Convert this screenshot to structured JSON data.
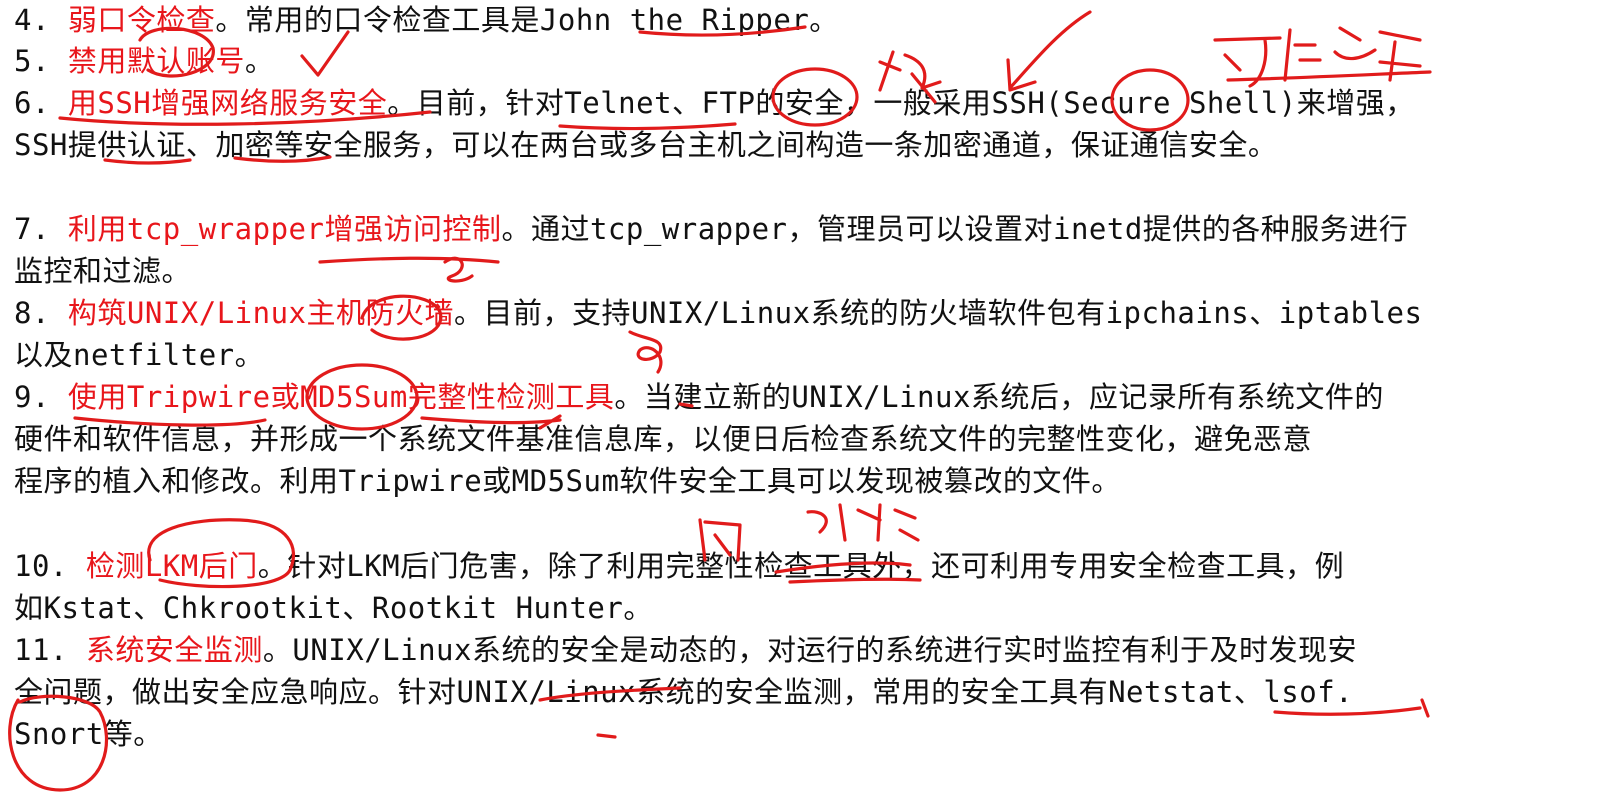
{
  "items": [
    {
      "num": "4. ",
      "title": "弱口令检查",
      "body": "。常用的口令检查工具是John the Ripper。"
    },
    {
      "num": "5. ",
      "title": "禁用默认账号",
      "body": "。"
    },
    {
      "num": "6. ",
      "title": "用SSH增强网络服务安全",
      "body": "。目前，针对Telnet、FTP的安全，一般采用SSH(Secure Shell)来增强，",
      "cont": [
        "SSH提供认证、加密等安全服务，可以在两台或多台主机之间构造一条加密通道，保证通信安全。"
      ]
    },
    {
      "num": "7. ",
      "title": "利用tcp_wrapper增强访问控制",
      "body": "。通过tcp_wrapper，管理员可以设置对inetd提供的各种服务进行",
      "cont": [
        "监控和过滤。"
      ]
    },
    {
      "num": "8. ",
      "title": "构筑UNIX/Linux主机防火墙",
      "body": "。目前，支持UNIX/Linux系统的防火墙软件包有ipchains、iptables",
      "cont": [
        "以及netfilter。"
      ]
    },
    {
      "num": "9. ",
      "title": "使用Tripwire或MD5Sum完整性检测工具",
      "body": "。当建立新的UNIX/Linux系统后，应记录所有系统文件的",
      "cont": [
        "硬件和软件信息，并形成一个系统文件基准信息库，以便日后检查系统文件的完整性变化，避免恶意",
        "程序的植入和修改。利用Tripwire或MD5Sum软件安全工具可以发现被篡改的文件。"
      ]
    },
    {
      "num": "10. ",
      "title": "检测LKM后门",
      "body": "。针对LKM后门危害，除了利用完整性检查工具外，还可利用专用安全检查工具，例",
      "cont": [
        "如Kstat、Chkrootkit、Rootkit Hunter。"
      ]
    },
    {
      "num": "11. ",
      "title": "系统安全监测",
      "body": "。UNIX/Linux系统的安全是动态的，对运行的系统进行实时监控有利于及时发现安",
      "cont": [
        "全问题，做出安全应急响应。针对UNIX/Linux系统的安全监测，常用的安全工具有Netstat、lsof.",
        "Snort等。"
      ]
    }
  ]
}
